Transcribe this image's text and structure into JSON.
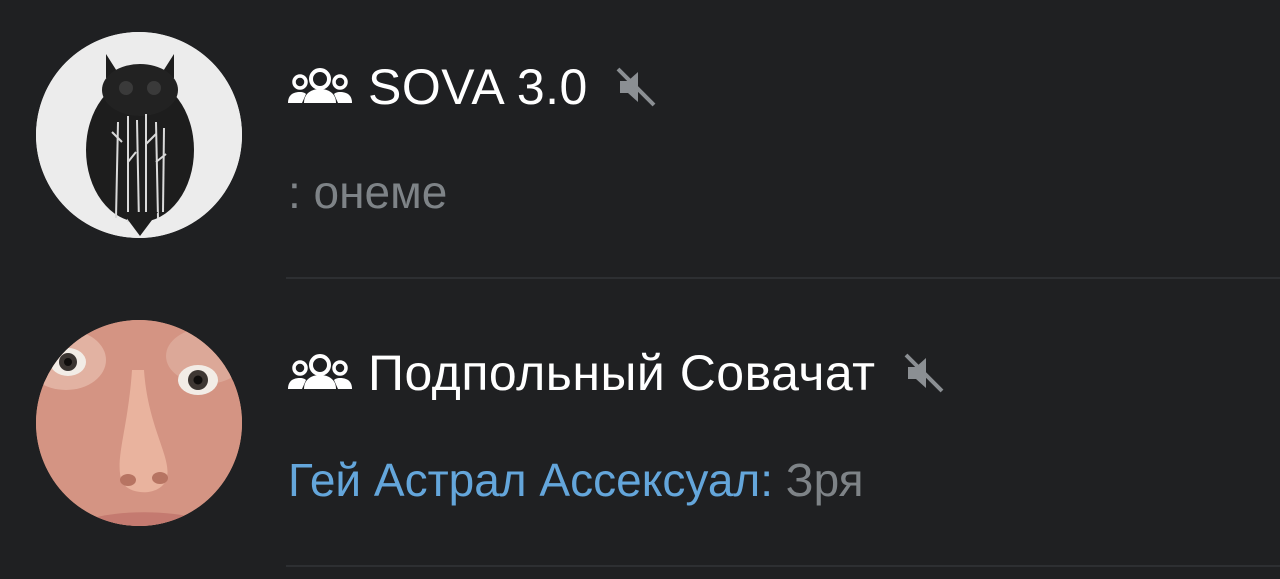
{
  "chats": [
    {
      "title": "SOVA 3.0",
      "type_icon": "group-icon",
      "muted": true,
      "status_icon": "muted-icon",
      "avatar": "owl-avatar",
      "sender": "",
      "message": ": онеме"
    },
    {
      "title": "Подпольный Совачат",
      "type_icon": "group-icon",
      "muted": true,
      "status_icon": "muted-icon",
      "avatar": "face-avatar",
      "sender": "Гей Астрал Ассексуал:",
      "message": " Зря"
    }
  ],
  "colors": {
    "background": "#1f2022",
    "title": "#ffffff",
    "sender": "#64a6db",
    "message": "#7e8387",
    "icon": "#8b8f93",
    "divider": "#2d2f32"
  }
}
